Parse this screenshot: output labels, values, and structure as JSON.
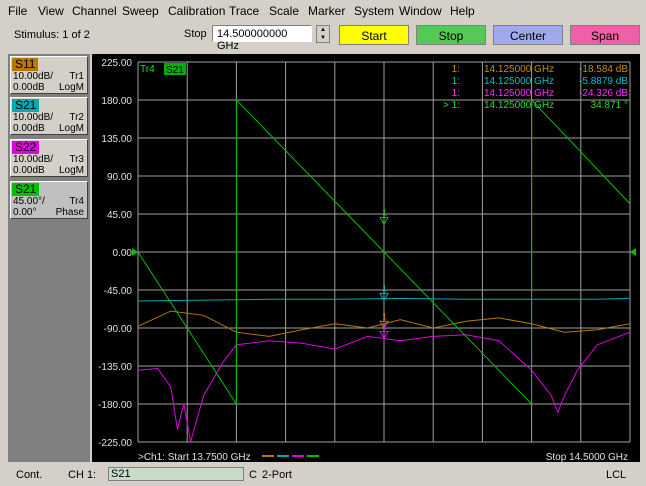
{
  "menu": [
    "File",
    "View",
    "Channel",
    "Sweep",
    "Calibration",
    "Trace",
    "Scale",
    "Marker",
    "System",
    "Window",
    "Help"
  ],
  "toolbar": {
    "stimulus": "Stimulus: 1 of 2",
    "stop_label": "Stop",
    "stop_value": "14.500000000 GHz",
    "buttons": [
      "Start",
      "Stop",
      "Center",
      "Span"
    ],
    "button_colors": [
      "#ffff00",
      "#55c855",
      "#a0a8f0",
      "#f060a8"
    ]
  },
  "traces": [
    {
      "param": "S11",
      "scale": "10.00dB/",
      "tr": "Tr1",
      "ref": "0.00dB",
      "format": "LogM",
      "color": "#b87800"
    },
    {
      "param": "S21",
      "scale": "10.00dB/",
      "tr": "Tr2",
      "ref": "0.00dB",
      "format": "LogM",
      "color": "#00a8b0"
    },
    {
      "param": "S22",
      "scale": "10.00dB/",
      "tr": "Tr3",
      "ref": "0.00dB",
      "format": "LogM",
      "color": "#e000e0"
    },
    {
      "param": "S21",
      "scale": "45.00°/",
      "tr": "Tr4",
      "ref": "0.00°",
      "format": "Phase",
      "color": "#00c000"
    }
  ],
  "chart_data": {
    "type": "line",
    "yticks": [
      "225.00",
      "180.00",
      "135.00",
      "90.00",
      "45.00",
      "0.00",
      "-45.00",
      "-90.00",
      "-135.00",
      "-180.00",
      "-225.00"
    ],
    "ylim": [
      -225,
      225
    ],
    "xlim_ghz": [
      13.75,
      14.5
    ],
    "active_trace_label": "Tr4",
    "active_trace_param": "S21",
    "start_label": ">Ch1: Start  13.7500 GHz",
    "stop_label": "Stop  14.5000 GHz",
    "marker_readouts": [
      {
        "label": "1:",
        "freq": "14.125000 GHz",
        "value": "-18.584 dB",
        "color": "#c89000"
      },
      {
        "label": "1:",
        "freq": "14.125000 GHz",
        "value": "-5.8879 dB",
        "color": "#00c0c8"
      },
      {
        "label": "1:",
        "freq": "14.125000 GHz",
        "value": "-24.326 dB",
        "color": "#ff30ff"
      },
      {
        "label": "> 1:",
        "freq": "14.125000 GHz",
        "value": "34.871 °",
        "color": "#20e020"
      }
    ],
    "marker_symbol": "1",
    "series": [
      {
        "color": "#00a8b0",
        "x": [
          13.75,
          13.85,
          13.95,
          14.05,
          14.15,
          14.25,
          14.35,
          14.45,
          14.5
        ],
        "y": [
          -58,
          -57,
          -56,
          -56,
          -55,
          -56,
          -56,
          -56,
          -55
        ]
      },
      {
        "color": "#b87800",
        "x": [
          13.75,
          13.8,
          13.85,
          13.9,
          13.95,
          14.0,
          14.05,
          14.1,
          14.15,
          14.2,
          14.25,
          14.3,
          14.35,
          14.4,
          14.45,
          14.5
        ],
        "y": [
          -88,
          -70,
          -75,
          -95,
          -100,
          -92,
          -85,
          -90,
          -80,
          -90,
          -82,
          -78,
          -85,
          -95,
          -92,
          -85
        ]
      },
      {
        "color": "#e000e0",
        "x": [
          13.75,
          13.78,
          13.8,
          13.81,
          13.82,
          13.83,
          13.85,
          13.88,
          13.9,
          13.95,
          14.0,
          14.05,
          14.1,
          14.15,
          14.2,
          14.25,
          14.3,
          14.35,
          14.38,
          14.39,
          14.4,
          14.42,
          14.45,
          14.5
        ],
        "y": [
          -140,
          -138,
          -160,
          -210,
          -180,
          -225,
          -170,
          -130,
          -110,
          -105,
          -108,
          -115,
          -100,
          -105,
          -100,
          -98,
          -105,
          -140,
          -170,
          -190,
          -170,
          -140,
          -110,
          -95
        ]
      },
      {
        "color": "#00c000",
        "x": [
          13.75,
          13.9,
          13.9001,
          14.35,
          14.3501,
          14.5
        ],
        "y": [
          0,
          -180,
          180,
          -180,
          180,
          57
        ]
      }
    ]
  },
  "status": {
    "mode": "Cont.",
    "channel": "CH 1:",
    "active": "S21",
    "cal": "C",
    "port": "2-Port",
    "ref": "LCL"
  }
}
